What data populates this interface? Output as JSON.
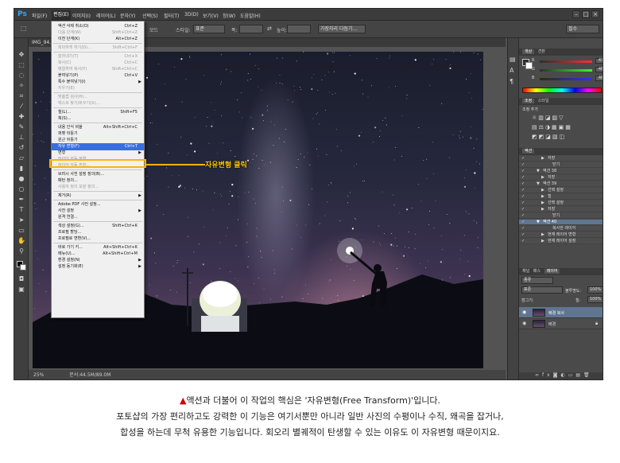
{
  "menubar": {
    "logo": "Ps",
    "items": [
      "파일(F)",
      "편집(E)",
      "이미지(I)",
      "레이어(L)",
      "문자(Y)",
      "선택(S)",
      "필터(T)",
      "3D(D)",
      "보기(V)",
      "창(W)",
      "도움말(H)"
    ],
    "window_buttons": [
      "–",
      "□",
      "×"
    ]
  },
  "optionsbar": {
    "mode_label": "모드",
    "style_label": "스타일:",
    "style_value": "표준",
    "width_label": "폭:",
    "height_label": "높이:",
    "refine_button": "가장자리 다듬기...",
    "workspace_value": "필수"
  },
  "document": {
    "tab_title": "IMG_94...",
    "zoom": "25%",
    "doc_info": "문서:44.5M/89.0M"
  },
  "edit_menu": {
    "items": [
      {
        "label": "액션 삭제 취소(O)",
        "shortcut": "Ctrl+Z",
        "disabled": false
      },
      {
        "label": "다음 단계(W)",
        "shortcut": "Shift+Ctrl+Z",
        "disabled": true
      },
      {
        "label": "이전 단계(K)",
        "shortcut": "Alt+Ctrl+Z",
        "disabled": false
      },
      {
        "sep": true
      },
      {
        "label": "희미하게 하기(D)...",
        "shortcut": "Shift+Ctrl+F",
        "disabled": true
      },
      {
        "sep": true
      },
      {
        "label": "잘라내기(T)",
        "shortcut": "Ctrl+X",
        "disabled": true
      },
      {
        "label": "복사(C)",
        "shortcut": "Ctrl+C",
        "disabled": true
      },
      {
        "label": "병합하여 복사(Y)",
        "shortcut": "Shift+Ctrl+C",
        "disabled": true
      },
      {
        "label": "붙여넣기(P)",
        "shortcut": "Ctrl+V",
        "disabled": false
      },
      {
        "label": "특수 붙여넣기(I)",
        "shortcut": "",
        "disabled": false,
        "submenu": true
      },
      {
        "label": "지우기(E)",
        "shortcut": "",
        "disabled": true
      },
      {
        "sep": true
      },
      {
        "label": "맞춤법 검사(H)...",
        "shortcut": "",
        "disabled": true
      },
      {
        "label": "텍스트 찾기/바꾸기(X)...",
        "shortcut": "",
        "disabled": true
      },
      {
        "sep": true
      },
      {
        "label": "칠(L)...",
        "shortcut": "Shift+F5",
        "disabled": false
      },
      {
        "label": "획(S)...",
        "shortcut": "",
        "disabled": false
      },
      {
        "sep": true
      },
      {
        "label": "내용 인식 비율",
        "shortcut": "Alt+Shift+Ctrl+C",
        "disabled": false
      },
      {
        "label": "퍼펫 뒤틀기",
        "shortcut": "",
        "disabled": false
      },
      {
        "label": "원근 뒤틀기",
        "shortcut": "",
        "disabled": false
      },
      {
        "label": "자유 변형(F)",
        "shortcut": "Ctrl+T",
        "disabled": false,
        "highlight": true
      },
      {
        "label": "변형",
        "shortcut": "",
        "disabled": false,
        "submenu": true
      },
      {
        "label": "레이어 자동 정렬...",
        "shortcut": "",
        "disabled": true
      },
      {
        "label": "레이어 자동 혼합...",
        "shortcut": "",
        "disabled": true
      },
      {
        "sep": true
      },
      {
        "label": "브러시 사전 설정 정의(B)...",
        "shortcut": "",
        "disabled": false
      },
      {
        "label": "패턴 정의...",
        "shortcut": "",
        "disabled": false
      },
      {
        "label": "사용자 정의 모양 정의...",
        "shortcut": "",
        "disabled": true
      },
      {
        "sep": true
      },
      {
        "label": "제거(R)",
        "shortcut": "",
        "disabled": false,
        "submenu": true
      },
      {
        "sep": true
      },
      {
        "label": "Adobe PDF 사전 설정...",
        "shortcut": "",
        "disabled": false
      },
      {
        "label": "사전 설정",
        "shortcut": "",
        "disabled": false,
        "submenu": true
      },
      {
        "label": "원격 연결...",
        "shortcut": "",
        "disabled": false
      },
      {
        "sep": true
      },
      {
        "label": "색상 설정(G)...",
        "shortcut": "Shift+Ctrl+K",
        "disabled": false
      },
      {
        "label": "프로필 할당...",
        "shortcut": "",
        "disabled": false
      },
      {
        "label": "프로필로 변환(V)...",
        "shortcut": "",
        "disabled": false
      },
      {
        "sep": true
      },
      {
        "label": "바로 가기 키...",
        "shortcut": "Alt+Shift+Ctrl+K",
        "disabled": false
      },
      {
        "label": "메뉴(U)...",
        "shortcut": "Alt+Shift+Ctrl+M",
        "disabled": false
      },
      {
        "label": "환경 설정(N)",
        "shortcut": "",
        "disabled": false,
        "submenu": true
      },
      {
        "label": "설정 동기화(E)",
        "shortcut": "",
        "disabled": false,
        "submenu": true
      }
    ]
  },
  "callout": {
    "text": "자유변형 클릭"
  },
  "color_panel": {
    "tabs": [
      "색상",
      "견본"
    ],
    "r_label": "R",
    "g_label": "G",
    "b_label": "B",
    "r_value": "47",
    "g_value": "46",
    "b_value": "46"
  },
  "adjust_panel": {
    "tabs": [
      "조정",
      "스타일"
    ],
    "header": "조정 추가"
  },
  "actions_panel": {
    "tab": "액션",
    "rows": [
      {
        "label": "저장",
        "indent": 2,
        "selected": false
      },
      {
        "label": "닫기",
        "indent": 3,
        "selected": false
      },
      {
        "label": "액션 38",
        "indent": 1,
        "selected": false
      },
      {
        "label": "저장",
        "indent": 2,
        "selected": false
      },
      {
        "label": "액션 39",
        "indent": 1,
        "selected": false
      },
      {
        "label": "선택 설정",
        "indent": 2,
        "selected": false
      },
      {
        "label": "칠",
        "indent": 2,
        "selected": false
      },
      {
        "label": "선택 설정",
        "indent": 2,
        "selected": false
      },
      {
        "label": "저장",
        "indent": 2,
        "selected": false
      },
      {
        "label": "닫기",
        "indent": 3,
        "selected": false
      },
      {
        "label": "액션 40",
        "indent": 1,
        "selected": true
      },
      {
        "label": "복사한 레이어",
        "indent": 3,
        "selected": false
      },
      {
        "label": "현재 레이어 변형",
        "indent": 2,
        "selected": false
      },
      {
        "label": "현재 레이어 설정",
        "indent": 2,
        "selected": false
      }
    ]
  },
  "layers_panel": {
    "tabs": [
      "채널",
      "패스",
      "레이어"
    ],
    "kind_value": "종류",
    "blend_value": "표준",
    "opacity_label": "불투명도:",
    "opacity_value": "100%",
    "lock_label": "잠그기:",
    "fill_label": "칠:",
    "fill_value": "100%",
    "layers": [
      {
        "name": "배경 복사",
        "selected": true
      },
      {
        "name": "배경",
        "selected": false
      }
    ]
  },
  "caption": {
    "triangle": "▲",
    "line1": "액션과 더불어 이 작업의 핵심은 '자유변형(Free Transform)'입니다.",
    "line2": "포토샵의 가장 편리하고도 강력한 이 기능은 여기서뿐만 아니라 일반 사진의 수평이나 수직, 왜곡을 잡거나,",
    "line3": "합성을 하는데 무척 유용한 기능입니다. 회오리 별궤적이 탄생할 수 있는 이유도 이 자유변형 때문이지요."
  }
}
